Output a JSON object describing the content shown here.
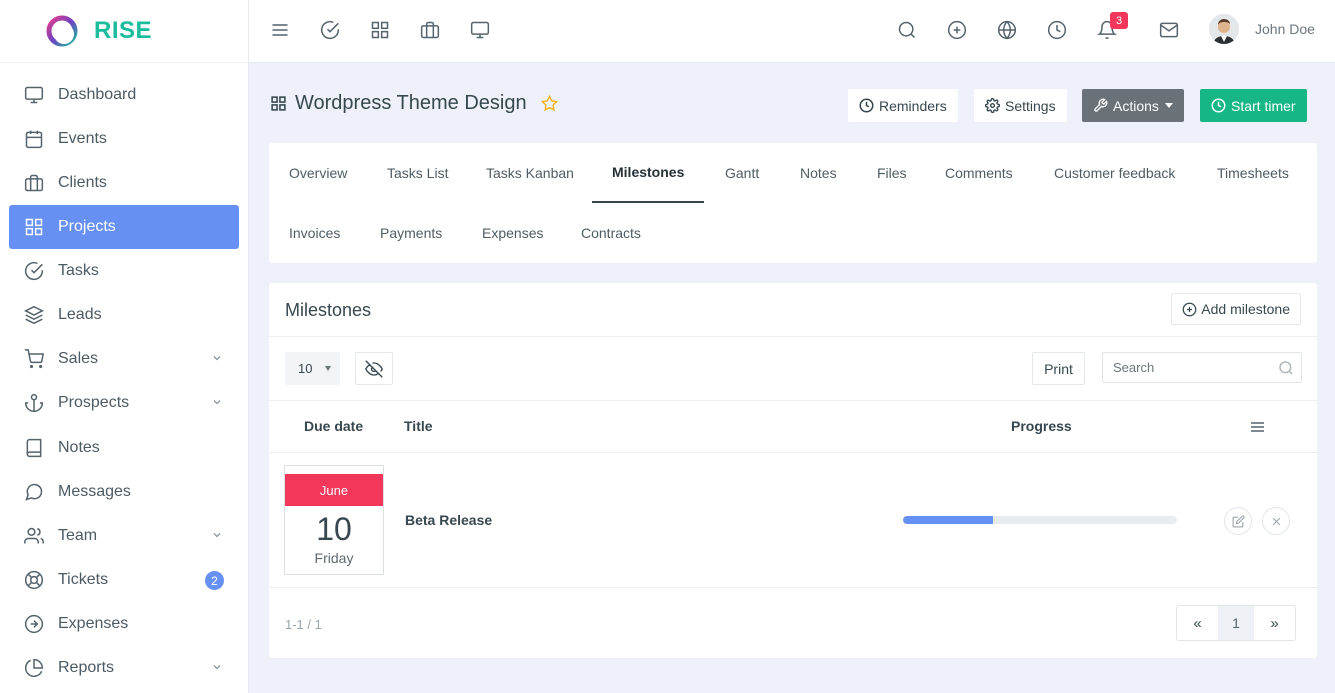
{
  "brand": {
    "name": "RISE"
  },
  "sidebar": {
    "items": [
      {
        "label": "Dashboard",
        "icon": "monitor-icon"
      },
      {
        "label": "Events",
        "icon": "calendar-icon"
      },
      {
        "label": "Clients",
        "icon": "briefcase-icon"
      },
      {
        "label": "Projects",
        "icon": "grid-icon",
        "active": true
      },
      {
        "label": "Tasks",
        "icon": "check-circle-icon"
      },
      {
        "label": "Leads",
        "icon": "layers-icon"
      },
      {
        "label": "Sales",
        "icon": "shopping-cart-icon",
        "expandable": true
      },
      {
        "label": "Prospects",
        "icon": "anchor-icon",
        "expandable": true
      },
      {
        "label": "Notes",
        "icon": "book-icon"
      },
      {
        "label": "Messages",
        "icon": "message-circle-icon"
      },
      {
        "label": "Team",
        "icon": "users-icon",
        "expandable": true
      },
      {
        "label": "Tickets",
        "icon": "life-buoy-icon",
        "badge": "2"
      },
      {
        "label": "Expenses",
        "icon": "arrow-right-circle-icon"
      },
      {
        "label": "Reports",
        "icon": "pie-chart-icon",
        "expandable": true
      }
    ]
  },
  "topbar": {
    "notification_count": "3",
    "user_name": "John Doe"
  },
  "project": {
    "title": "Wordpress Theme Design",
    "buttons": {
      "reminders": "Reminders",
      "settings": "Settings",
      "actions": "Actions",
      "start_timer": "Start timer"
    }
  },
  "tabs": [
    "Overview",
    "Tasks List",
    "Tasks Kanban",
    "Milestones",
    "Gantt",
    "Notes",
    "Files",
    "Comments",
    "Customer feedback",
    "Timesheets",
    "Invoices",
    "Payments",
    "Expenses",
    "Contracts"
  ],
  "active_tab": "Milestones",
  "milestones": {
    "title": "Milestones",
    "add_button": "Add milestone",
    "page_size": "10",
    "print_label": "Print",
    "search_placeholder": "Search",
    "columns": {
      "due_date": "Due date",
      "title": "Title",
      "progress": "Progress"
    },
    "rows": [
      {
        "month": "June",
        "day": "10",
        "weekday": "Friday",
        "title": "Beta Release",
        "progress": 0.33
      }
    ],
    "pagination_info": "1-1 / 1",
    "current_page": "1",
    "prev_label": "«",
    "next_label": "»"
  },
  "colors": {
    "accent": "#6690f4",
    "brand": "#1abc9c",
    "success": "#17b686",
    "danger": "#f2375a"
  }
}
